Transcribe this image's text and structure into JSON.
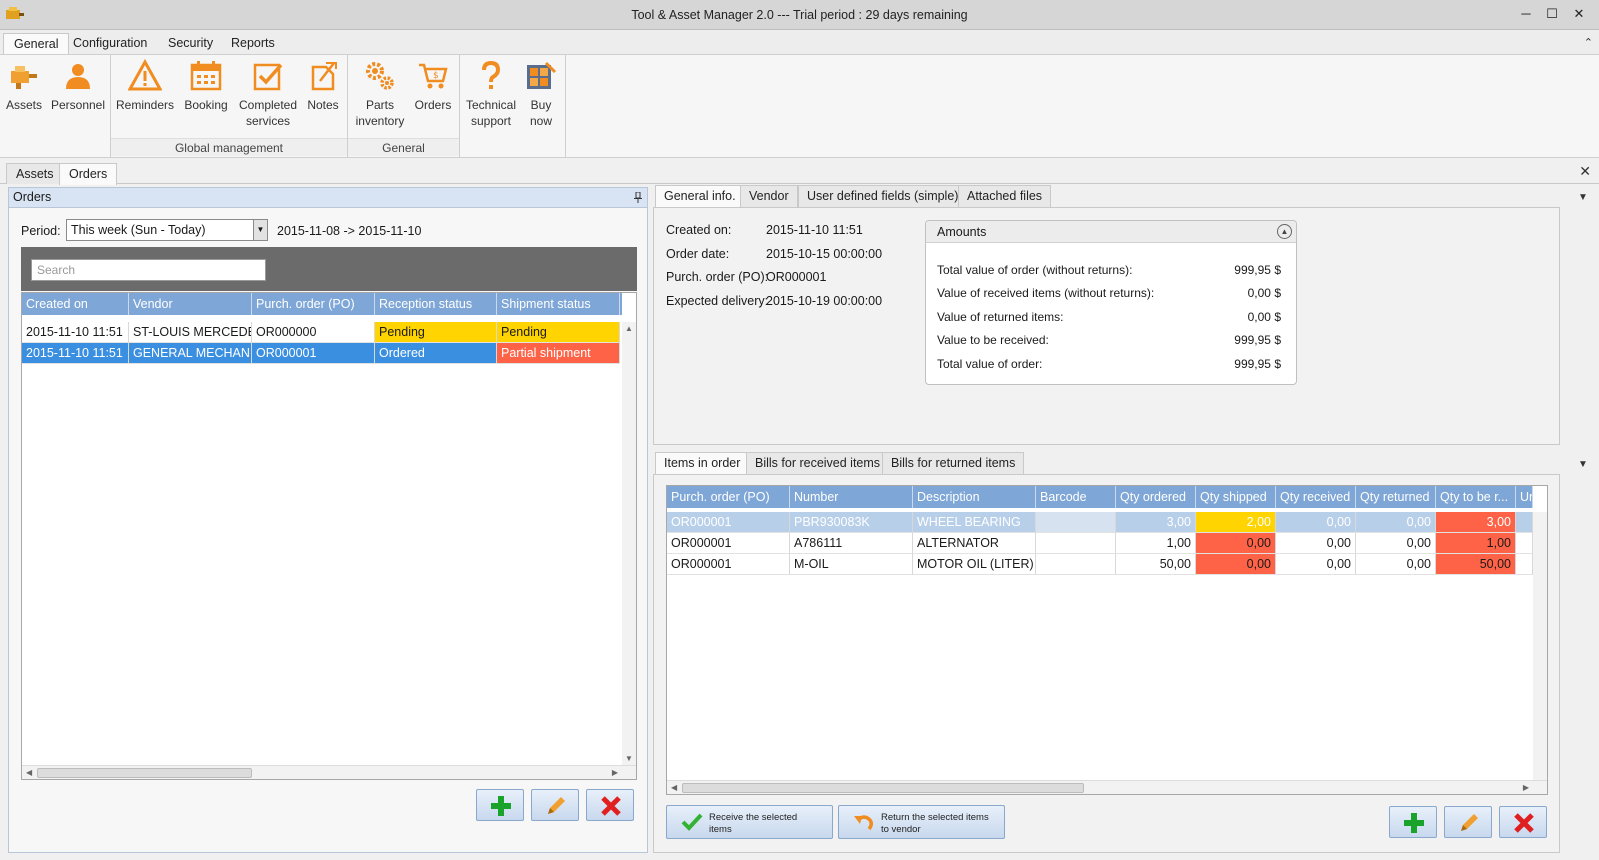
{
  "window": {
    "title": "Tool & Asset Manager 2.0 --- Trial period : 29 days remaining",
    "minimize": "─",
    "maximize": "☐",
    "close": "✕"
  },
  "ribbon": {
    "tabs": [
      "General",
      "Configuration",
      "Security",
      "Reports"
    ],
    "active_tab": "General",
    "collapse": "⌃",
    "groups": [
      {
        "label": "",
        "buttons": [
          "Assets",
          "Personnel"
        ]
      },
      {
        "label": "Global management",
        "buttons": [
          "Reminders",
          "Booking",
          "Completed services",
          "Notes"
        ]
      },
      {
        "label": "General",
        "buttons": [
          "Parts inventory",
          "Orders"
        ]
      },
      {
        "label": "",
        "buttons": [
          "Technical support",
          "Buy now"
        ]
      }
    ],
    "btn_lines": {
      "assets": "Assets",
      "personnel": "Personnel",
      "reminders": "Reminders",
      "booking": "Booking",
      "completed_1": "Completed",
      "completed_2": "services",
      "notes": "Notes",
      "parts_1": "Parts",
      "parts_2": "inventory",
      "orders": "Orders",
      "support_1": "Technical",
      "support_2": "support",
      "buy_1": "Buy",
      "buy_2": "now"
    },
    "group_labels": {
      "global": "Global management",
      "general": "General"
    }
  },
  "doc_tabs": {
    "assets": "Assets",
    "orders": "Orders",
    "close": "✕"
  },
  "orders_panel": {
    "title": "Orders",
    "pin": "📌",
    "period_label": "Period:",
    "period_value": "This week (Sun - Today)",
    "period_range": "2015-11-08  ->  2015-11-10",
    "search_placeholder": "Search",
    "columns": [
      "Created on",
      "Vendor",
      "Purch. order (PO)",
      "Reception status",
      "Shipment status"
    ],
    "rows": [
      {
        "created": "2015-11-10 11:51",
        "vendor": "ST-LOUIS MERCEDE...",
        "po": "OR000000",
        "reception": "Pending",
        "shipment": "Pending"
      },
      {
        "created": "2015-11-10 11:51",
        "vendor": "GENERAL MECHANI...",
        "po": "OR000001",
        "reception": "Ordered",
        "shipment": "Partial shipment"
      }
    ]
  },
  "detail_tabs": [
    "General info.",
    "Vendor",
    "User defined fields (simple)",
    "Attached files"
  ],
  "general_info": {
    "created_label": "Created on:",
    "created_value": "2015-11-10 11:51",
    "order_date_label": "Order date:",
    "order_date_value": "2015-10-15 00:00:00",
    "po_label": "Purch. order (PO):",
    "po_value": "OR000001",
    "expected_label": "Expected delivery:",
    "expected_value": "2015-10-19 00:00:00"
  },
  "amounts": {
    "title": "Amounts",
    "collapse": "▲",
    "lines": [
      {
        "label": "Total value of order (without returns):",
        "value": "999,95 $"
      },
      {
        "label": "Value of received items (without returns):",
        "value": "0,00 $"
      },
      {
        "label": "Value of returned items:",
        "value": "0,00 $"
      },
      {
        "label": "Value to be received:",
        "value": "999,95 $"
      },
      {
        "label": "Total value of order:",
        "value": "999,95 $"
      }
    ]
  },
  "items_tabs": [
    "Items in order",
    "Bills for received items",
    "Bills for returned items"
  ],
  "items": {
    "columns": [
      "Purch. order (PO)",
      "Number",
      "Description",
      "Barcode",
      "Qty ordered",
      "Qty shipped",
      "Qty received",
      "Qty returned",
      "Qty to be r...",
      "Unit"
    ],
    "rows": [
      {
        "po": "OR000001",
        "number": "PBR930083K",
        "desc": "WHEEL BEARING",
        "barcode": "",
        "ordered": "3,00",
        "shipped": "2,00",
        "received": "0,00",
        "returned": "0,00",
        "to_receive": "3,00"
      },
      {
        "po": "OR000001",
        "number": "A786111",
        "desc": "ALTERNATOR",
        "barcode": "",
        "ordered": "1,00",
        "shipped": "0,00",
        "received": "0,00",
        "returned": "0,00",
        "to_receive": "1,00"
      },
      {
        "po": "OR000001",
        "number": "M-OIL",
        "desc": "MOTOR OIL (LITER)",
        "barcode": "",
        "ordered": "50,00",
        "shipped": "0,00",
        "received": "0,00",
        "returned": "0,00",
        "to_receive": "50,00"
      }
    ]
  },
  "buttons": {
    "receive_1": "Receive the selected",
    "receive_2": "items",
    "return_1": "Return the selected items",
    "return_2": "to vendor"
  },
  "colors": {
    "header_blue": "#7ea6d6",
    "selected_row": "#3b8fe0",
    "pending_yellow": "#ffd400",
    "alert_red": "#ff6347",
    "add_green": "#1aa32a",
    "delete_red": "#e02020"
  }
}
